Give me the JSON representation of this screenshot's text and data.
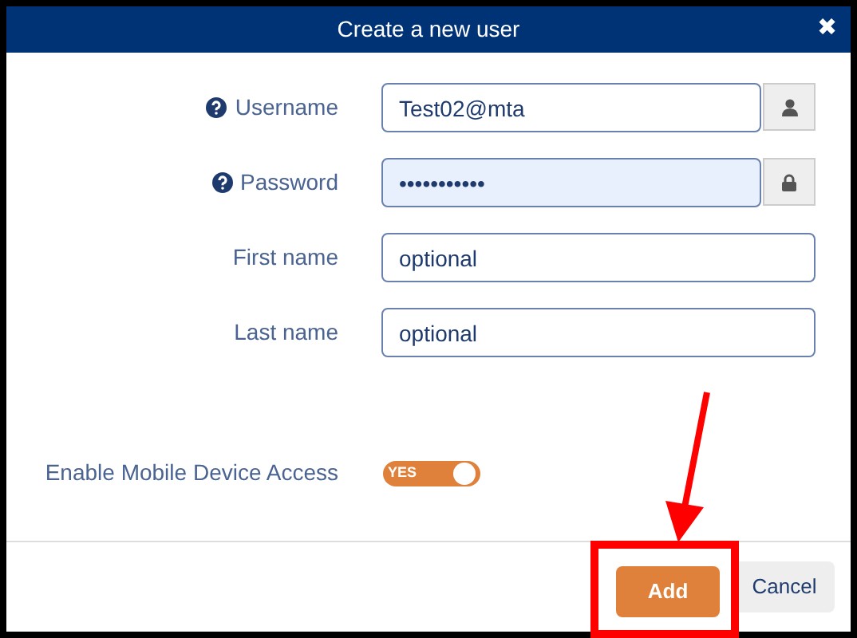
{
  "dialog": {
    "title": "Create a new user",
    "close": "✖"
  },
  "fields": [
    {
      "label": "Username",
      "help": true,
      "value": "Test02@mta",
      "kind": "user",
      "autofilled": false
    },
    {
      "label": "Password",
      "help": true,
      "value": "•••••••••••",
      "kind": "lock",
      "autofilled": true
    },
    {
      "label": "First name",
      "help": false,
      "placeholder": "optional",
      "kind": "plain",
      "autofilled": false
    },
    {
      "label": "Last name",
      "help": false,
      "placeholder": "optional",
      "kind": "plain",
      "autofilled": false
    }
  ],
  "toggle": {
    "label": "Enable Mobile Device Access",
    "on": true,
    "text": "YES"
  },
  "buttons": [
    {
      "label": "Add",
      "kind": "primary",
      "highlighted": true
    },
    {
      "label": "Cancel",
      "kind": "secondary",
      "highlighted": false
    }
  ]
}
